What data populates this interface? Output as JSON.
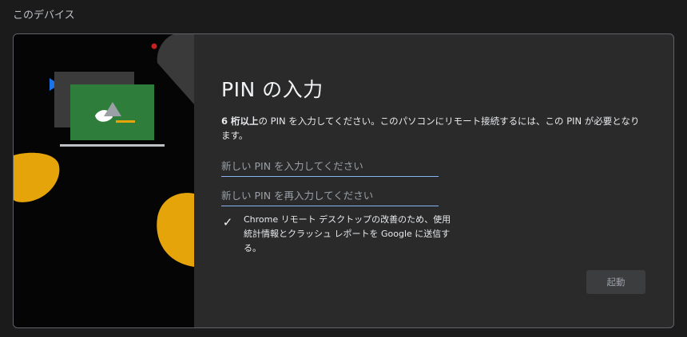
{
  "section": {
    "title": "このデバイス"
  },
  "dialog": {
    "title": "PIN の入力",
    "description_bold": "6 桁以上",
    "description_rest": "の PIN を入力してください。このパソコンにリモート接続するには、この PIN が必要となります。",
    "pin_placeholder": "新しい PIN を入力してください",
    "pin_confirm_placeholder": "新しい PIN を再入力してください",
    "consent_checked": true,
    "consent_text": "Chrome リモート デスクトップの改善のため、使用統計情報とクラッシュ レポートを Google に送信する。",
    "start_label": "起動"
  },
  "colors": {
    "accent": "#8ab4f8",
    "blob_yellow": "#e5a50a",
    "screen_green": "#2f7d3a",
    "play_blue": "#1a73e8",
    "dot_red": "#c5221f"
  },
  "icons": {
    "checkbox": "check-icon"
  }
}
